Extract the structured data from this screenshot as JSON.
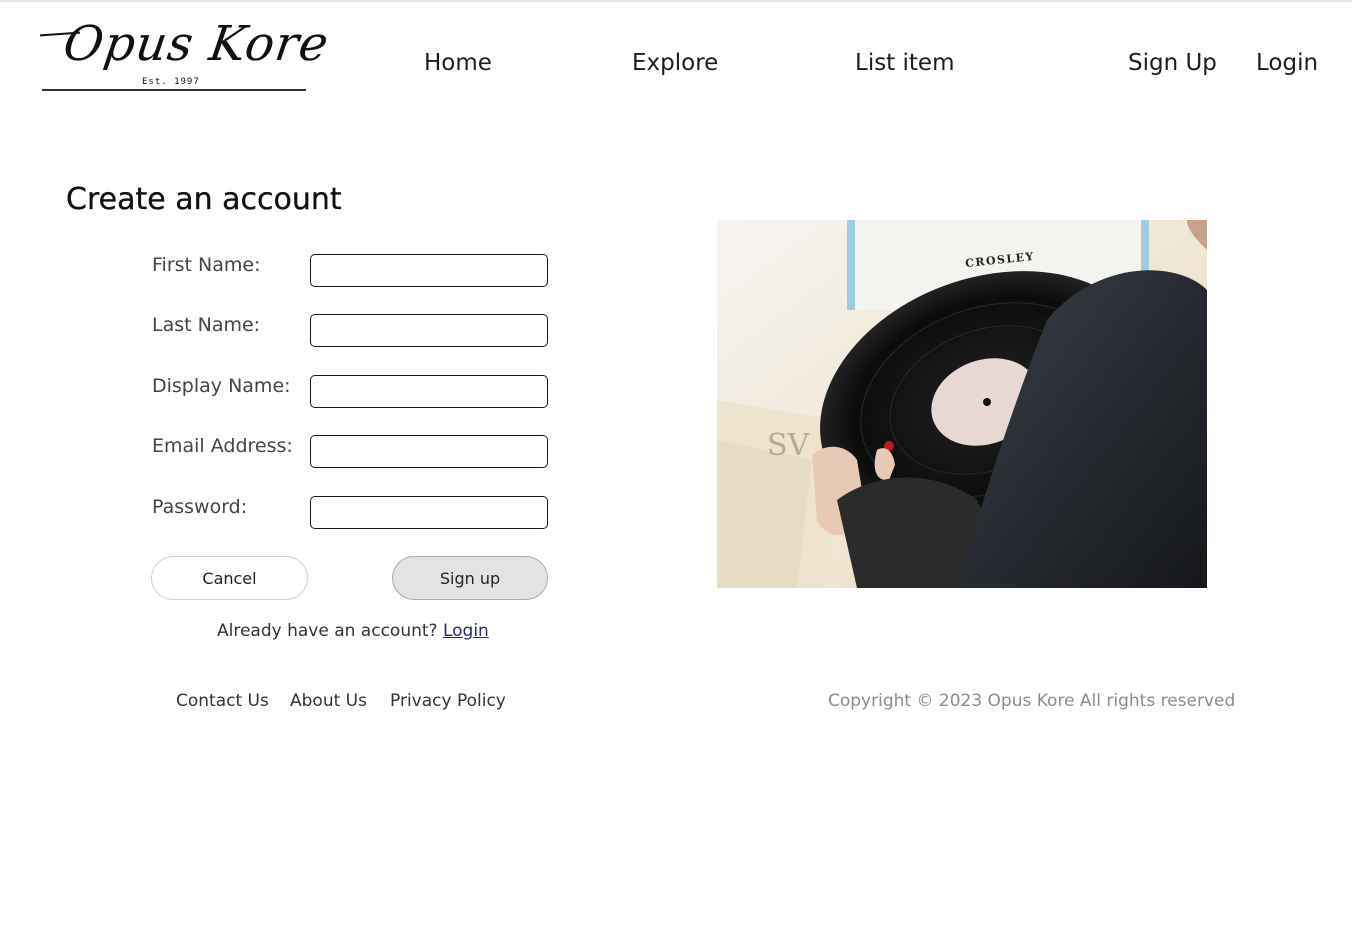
{
  "brand": {
    "logo_script": "Opus Kore",
    "logo_est": "Est. 1997"
  },
  "nav": {
    "home": "Home",
    "explore": "Explore",
    "list_item": "List item",
    "sign_up": "Sign Up",
    "login": "Login"
  },
  "form": {
    "title": "Create an account",
    "fields": [
      {
        "label": "First Name:",
        "value": ""
      },
      {
        "label": "Last Name:",
        "value": ""
      },
      {
        "label": "Display Name:",
        "value": ""
      },
      {
        "label": "Email Address:",
        "value": ""
      },
      {
        "label": "Password:",
        "value": ""
      }
    ],
    "cancel_label": "Cancel",
    "signup_label": "Sign up",
    "login_prompt": "Already have an account?",
    "login_link": "Login"
  },
  "hero": {
    "turntable_brand": "CROSLEY"
  },
  "footer": {
    "contact": "Contact Us",
    "about": "About Us",
    "privacy": "Privacy Policy",
    "copyright": "Copyright © 2023 Opus Kore All rights reserved"
  },
  "colors": {
    "signup_button_bg": "#e3e3e3",
    "login_link": "#2a2a6e",
    "copyright_text": "#8c8c8c"
  }
}
